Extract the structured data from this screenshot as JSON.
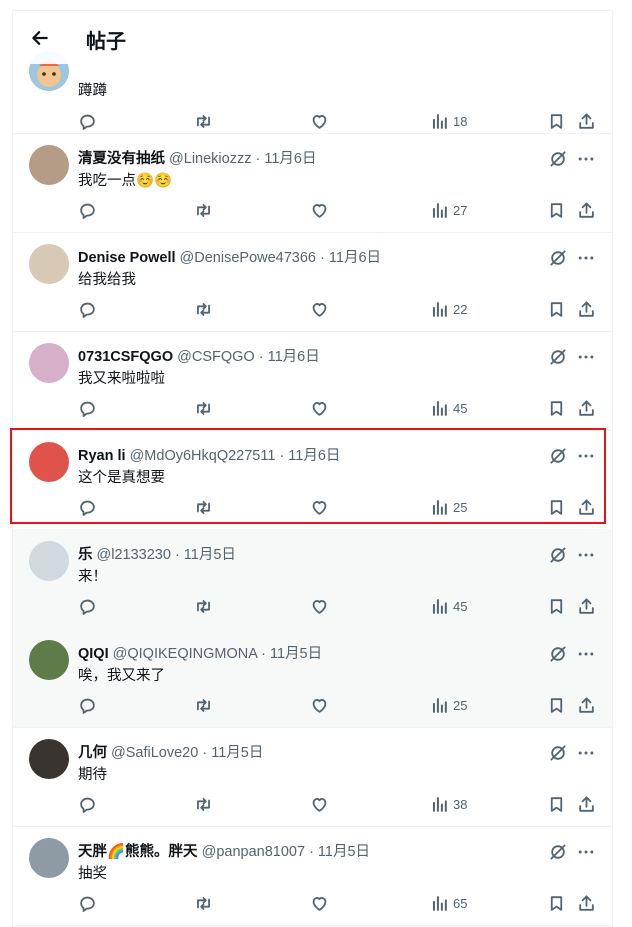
{
  "header": {
    "title": "帖子"
  },
  "top_post": {
    "text": "蹲蹲",
    "views": "18"
  },
  "posts": [
    {
      "name": "清夏没有抽纸",
      "handle": "@Linekiozzz",
      "date": "· 11月6日",
      "text": "我吃一点☺️☺️",
      "views": "27",
      "avatar_color": "#b59c86"
    },
    {
      "name": "Denise Powell",
      "handle": "@DenisePowe47366",
      "date": "· 11月6日",
      "text": "给我给我",
      "views": "22",
      "avatar_color": "#d8c9b4"
    },
    {
      "name": "0731CSFQGO",
      "handle": "@CSFQGO",
      "date": "· 11月6日",
      "text": "我又来啦啦啦",
      "views": "45",
      "avatar_color": "#d6b0c8"
    },
    {
      "name": "Ryan li",
      "handle": "@MdOy6HkqQ227511",
      "date": "· 11月6日",
      "text": "这个是真想要",
      "views": "25",
      "avatar_color": "#e0534a"
    },
    {
      "name": "乐",
      "handle": "@l2133230",
      "date": "· 11月5日",
      "text": "来！",
      "views": "45",
      "avatar_color": "#cfd9de"
    },
    {
      "name": "QIQI",
      "handle": "@QIQIKEQINGMONA",
      "date": "· 11月5日",
      "text": "唉，我又来了",
      "views": "25",
      "avatar_color": "#5e7b4a"
    },
    {
      "name": "几何",
      "handle": "@SafiLove20",
      "date": "· 11月5日",
      "text": "期待",
      "views": "38",
      "avatar_color": "#3a3430"
    },
    {
      "name": "天胖🌈熊熊。胖天",
      "handle": "@panpan81007",
      "date": "· 11月5日",
      "text": "抽奖",
      "views": "65",
      "avatar_color": "#8e9aa4"
    }
  ],
  "colors": {
    "highlight": "#e3141b",
    "icon": "#536471",
    "border": "#eff3f4"
  },
  "icons": [
    "back-arrow-icon",
    "reply-icon",
    "retweet-icon",
    "like-icon",
    "views-icon",
    "bookmark-icon",
    "share-icon",
    "grok-icon",
    "more-icon"
  ]
}
